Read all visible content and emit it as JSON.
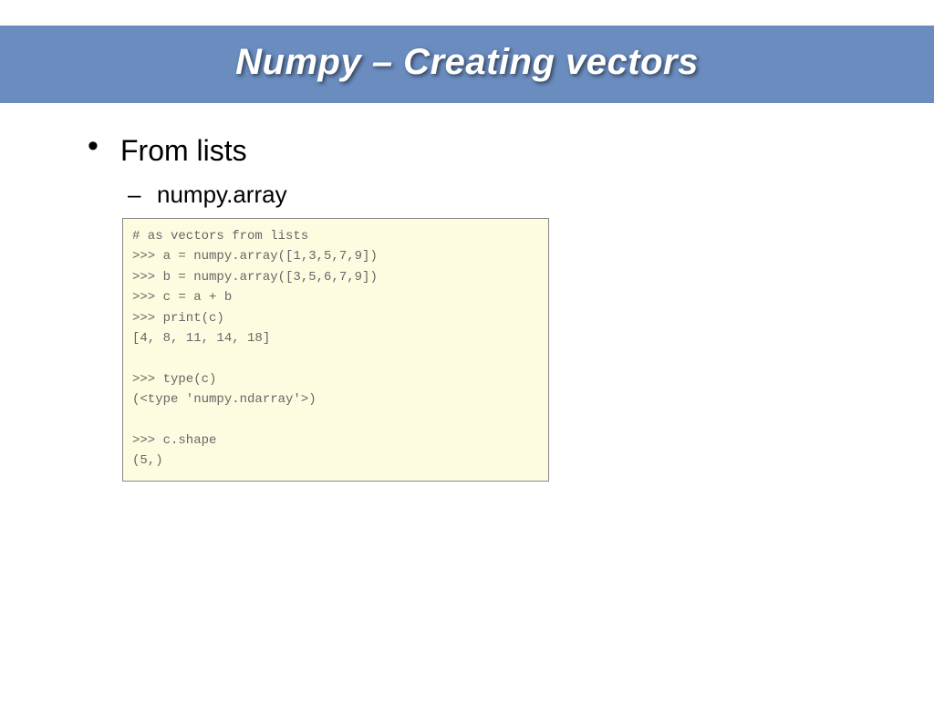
{
  "title": "Numpy – Creating vectors",
  "bullets": {
    "b1": "From lists",
    "b1_sub1": "numpy.array"
  },
  "code": "# as vectors from lists\n>>> a = numpy.array([1,3,5,7,9])\n>>> b = numpy.array([3,5,6,7,9])\n>>> c = a + b\n>>> print(c)\n[4, 8, 11, 14, 18]\n\n>>> type(c)\n(<type 'numpy.ndarray'>)\n\n>>> c.shape\n(5,)"
}
